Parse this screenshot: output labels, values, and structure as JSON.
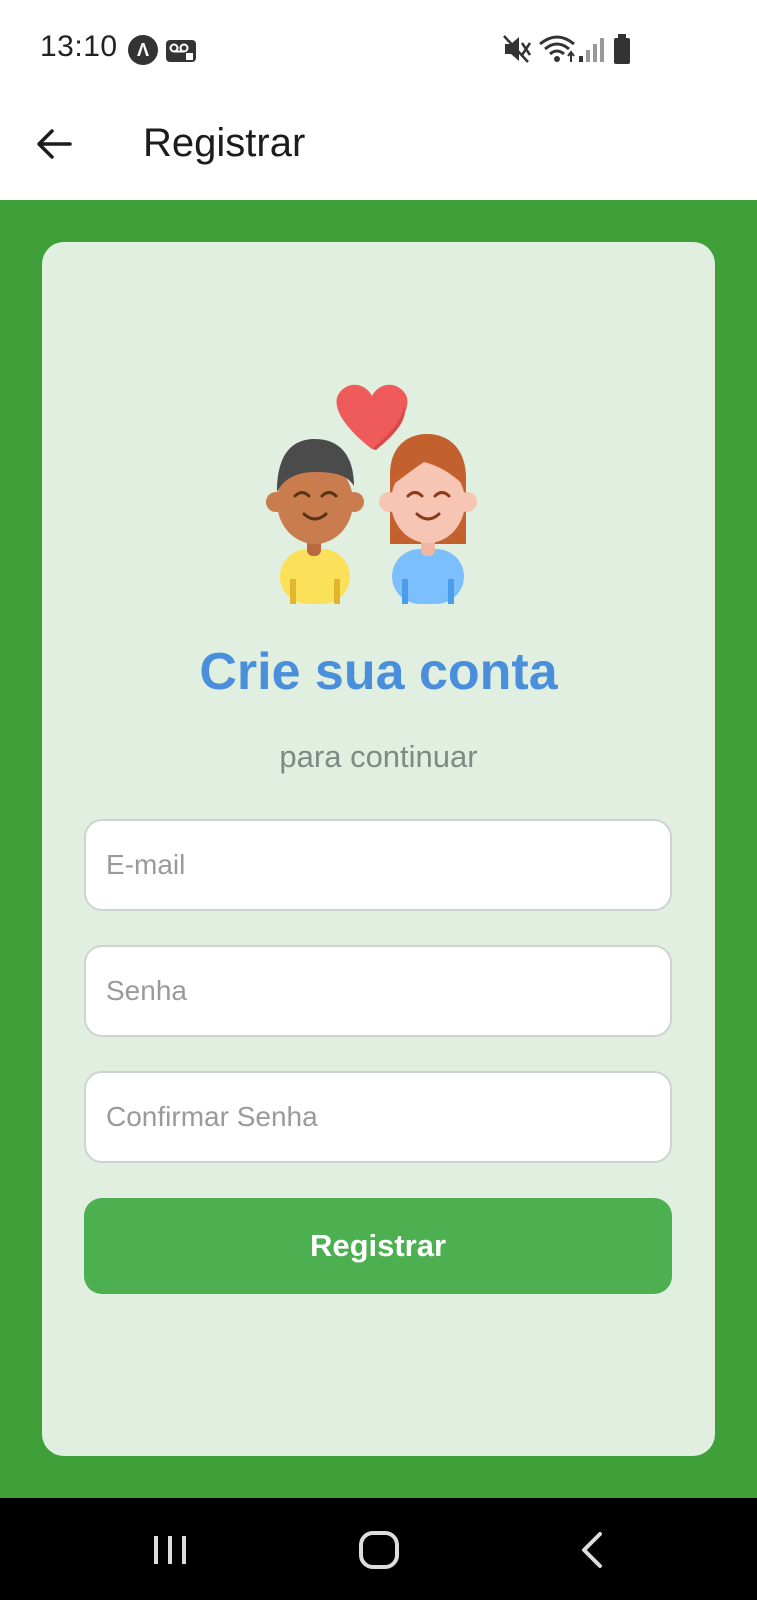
{
  "status_bar": {
    "time": "13:10",
    "app_icon_letter": "Λ",
    "icons": [
      "notification-app-icon",
      "voicemail-icon",
      "mute-icon",
      "wifi-icon",
      "signal-icon",
      "battery-icon"
    ]
  },
  "app_bar": {
    "title": "Registrar",
    "back_icon": "arrow-left-icon"
  },
  "card": {
    "illustration": "couple-with-heart-illustration",
    "title": "Crie sua conta",
    "subtitle": "para continuar",
    "fields": {
      "email_placeholder": "E-mail",
      "password_placeholder": "Senha",
      "confirm_placeholder": "Confirmar Senha"
    },
    "submit_label": "Registrar"
  },
  "nav_bar": {
    "icons": [
      "recents-icon",
      "home-icon",
      "back-icon"
    ]
  },
  "colors": {
    "background_green": "#3f9f39",
    "card_bg": "#e1efe1",
    "title_blue": "#4a8fdc",
    "button_green": "#4caf50"
  }
}
